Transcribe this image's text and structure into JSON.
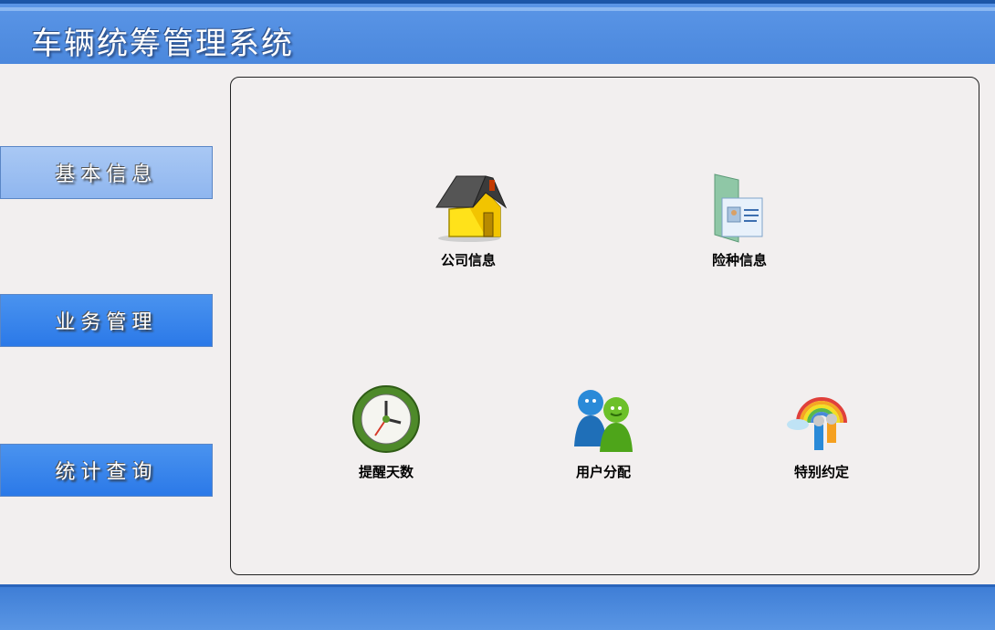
{
  "app": {
    "title": "车辆统筹管理系统"
  },
  "sidebar": {
    "items": [
      {
        "label": "基本信息",
        "active": true
      },
      {
        "label": "业务管理",
        "active": false
      },
      {
        "label": "统计查询",
        "active": false
      }
    ]
  },
  "main": {
    "tiles": [
      {
        "label": "公司信息",
        "icon": "house-icon"
      },
      {
        "label": "险种信息",
        "icon": "id-card-folder-icon"
      },
      {
        "label": "提醒天数",
        "icon": "clock-icon"
      },
      {
        "label": "用户分配",
        "icon": "users-icon"
      },
      {
        "label": "特别约定",
        "icon": "rainbow-people-icon"
      }
    ]
  },
  "colors": {
    "header_blue": "#5a95e6",
    "nav_active": "#9bbff2",
    "nav_normal": "#3384ec",
    "panel_bg": "#f2efef"
  }
}
